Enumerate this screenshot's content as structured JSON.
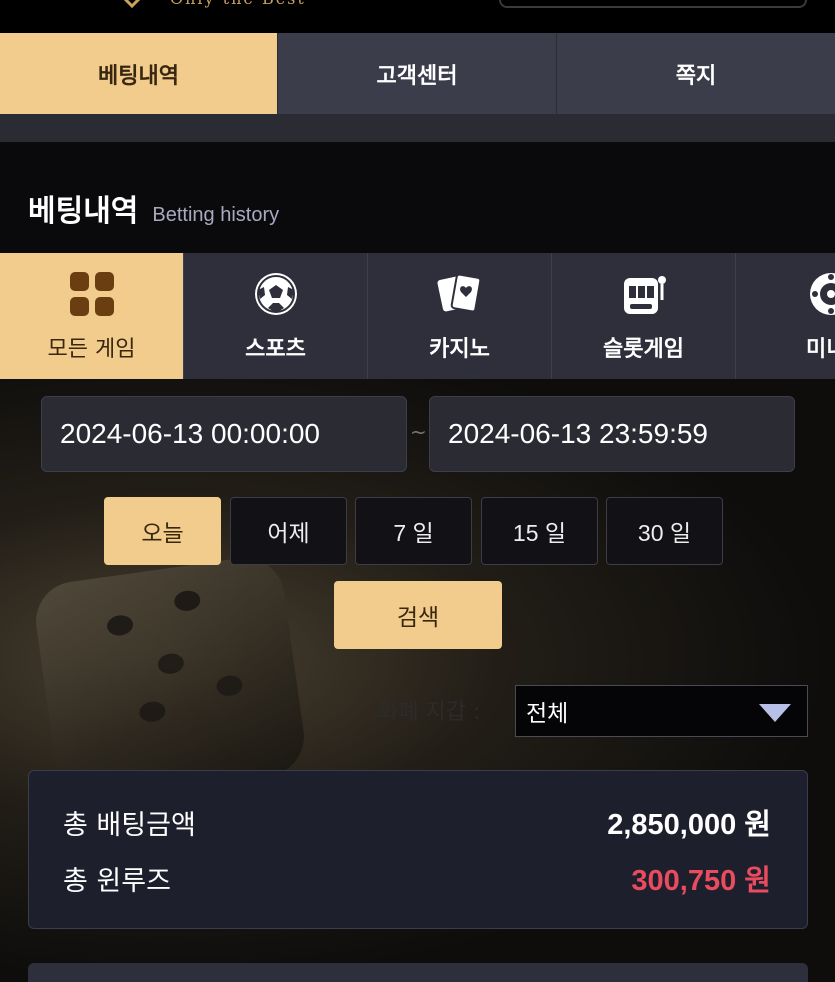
{
  "header": {
    "logo_tagline": "Only the Best"
  },
  "nav": {
    "tabs": [
      {
        "label": "베팅내역",
        "active": true
      },
      {
        "label": "고객센터",
        "active": false
      },
      {
        "label": "쪽지",
        "active": false
      }
    ]
  },
  "page": {
    "title_ko": "베팅내역",
    "title_en": "Betting history"
  },
  "categories": [
    {
      "label": "모든 게임",
      "icon": "grid-icon",
      "active": true
    },
    {
      "label": "스포츠",
      "icon": "soccer-ball-icon",
      "active": false
    },
    {
      "label": "카지노",
      "icon": "playing-cards-icon",
      "active": false
    },
    {
      "label": "슬롯게임",
      "icon": "slot-machine-icon",
      "active": false
    },
    {
      "label": "미니",
      "icon": "roulette-icon",
      "active": false
    }
  ],
  "filters": {
    "date_from": "2024-06-13 00:00:00",
    "date_separator": "~",
    "date_to": "2024-06-13 23:59:59",
    "quick_ranges": [
      {
        "label": "오늘",
        "active": true
      },
      {
        "label": "어제",
        "active": false
      },
      {
        "label": "7 일",
        "active": false
      },
      {
        "label": "15 일",
        "active": false
      },
      {
        "label": "30 일",
        "active": false
      }
    ],
    "search_label": "검색",
    "wallet_label": "화폐 지갑 :",
    "wallet_selected": "전체"
  },
  "summary": {
    "total_bet_label": "총 배팅금액",
    "total_bet_value": "2,850,000 원",
    "total_winloss_label": "총 윈루즈",
    "total_winloss_value": "300,750 원"
  },
  "colors": {
    "accent": "#f1cc8c",
    "negative": "#ea4b5e",
    "nav_bg": "#3b3d4a"
  }
}
